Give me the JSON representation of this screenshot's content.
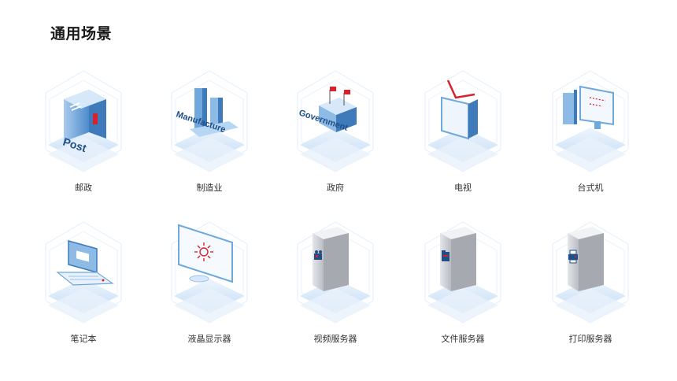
{
  "page": {
    "title": "通用场景"
  },
  "scenarios": [
    {
      "label": "邮政",
      "icon": "post-office-icon",
      "overlay_text": "Post"
    },
    {
      "label": "制造业",
      "icon": "factory-icon",
      "overlay_text": "Manufacture"
    },
    {
      "label": "政府",
      "icon": "government-building-icon",
      "overlay_text": "Government"
    },
    {
      "label": "电视",
      "icon": "tv-icon",
      "overlay_text": ""
    },
    {
      "label": "台式机",
      "icon": "desktop-computer-icon",
      "overlay_text": ""
    },
    {
      "label": "笔记本",
      "icon": "laptop-icon",
      "overlay_text": ""
    },
    {
      "label": "液晶显示器",
      "icon": "lcd-monitor-icon",
      "overlay_text": ""
    },
    {
      "label": "视频服务器",
      "icon": "video-server-icon",
      "overlay_text": ""
    },
    {
      "label": "文件服务器",
      "icon": "file-server-icon",
      "overlay_text": ""
    },
    {
      "label": "打印服务器",
      "icon": "print-server-icon",
      "overlay_text": ""
    }
  ],
  "colors": {
    "accent_red": "#d8222b",
    "platform_light": "#dcecfb",
    "platform_mid": "#b7d6f3",
    "building_blue": "#6fa8dc",
    "server_gray": "#b9bcc2"
  }
}
